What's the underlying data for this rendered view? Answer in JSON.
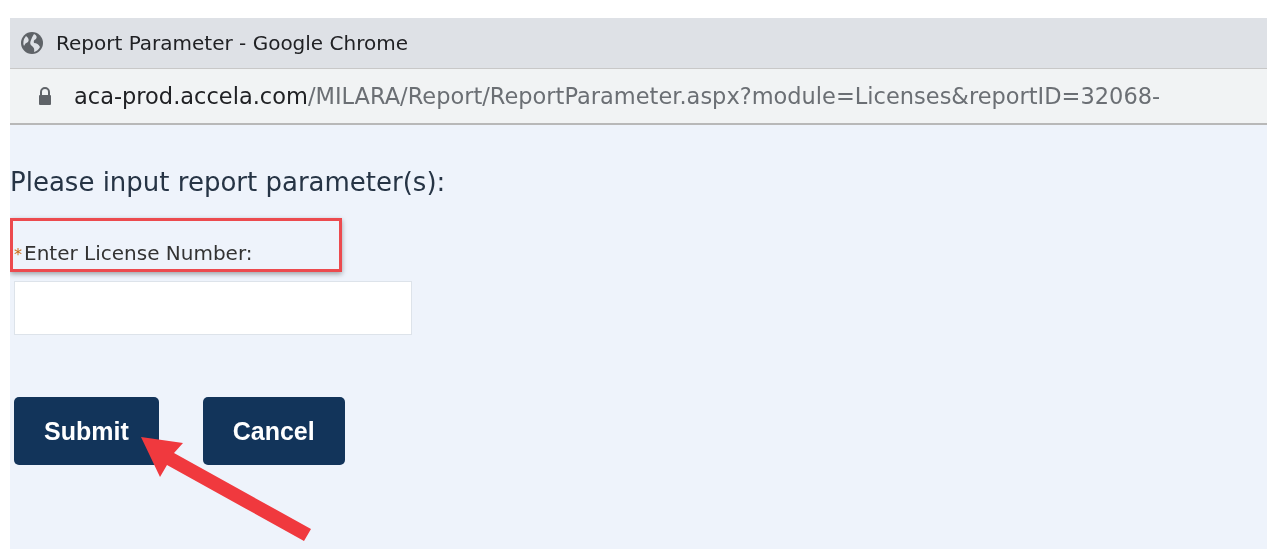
{
  "window": {
    "title": "Report Parameter - Google Chrome"
  },
  "address_bar": {
    "host": "aca-prod.accela.com",
    "path": "/MILARA/Report/ReportParameter.aspx?module=Licenses&reportID=32068-"
  },
  "heading": "Please input report parameter(s):",
  "field": {
    "required_mark": "*",
    "label": "Enter License Number:"
  },
  "buttons": [
    {
      "label": "Submit"
    },
    {
      "label": "Cancel"
    }
  ],
  "annotations": {
    "highlight_box": true,
    "arrow": true
  }
}
